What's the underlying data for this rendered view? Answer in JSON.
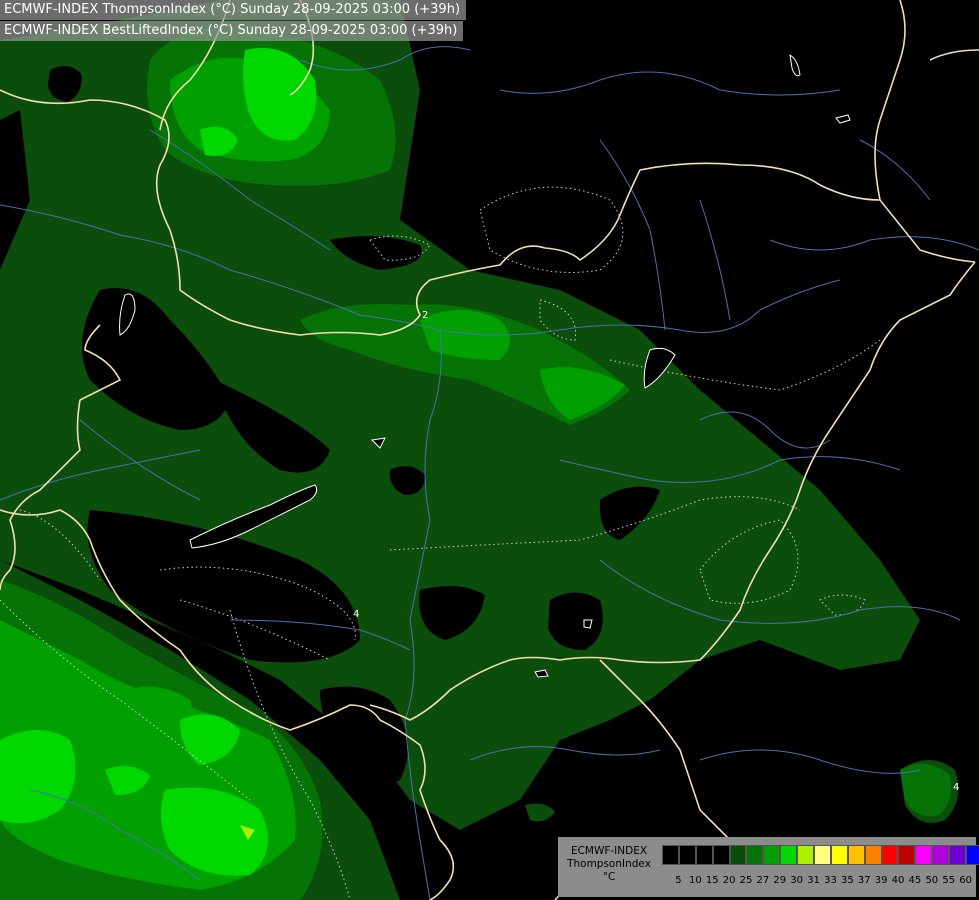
{
  "title": {
    "line1": "ECMWF-INDEX ThompsonIndex (°C) Sunday 28-09-2025 03:00 (+39h)",
    "line2": "ECMWF-INDEX BestLiftedIndex (°C) Sunday 28-09-2025 03:00 (+39h)"
  },
  "legend": {
    "model": "ECMWF-INDEX",
    "parameter": "ThompsonIndex",
    "unit": "°C",
    "ticks": [
      "5",
      "10",
      "15",
      "20",
      "25",
      "27",
      "29",
      "30",
      "31",
      "33",
      "35",
      "37",
      "39",
      "40",
      "45",
      "50",
      "55",
      "60"
    ],
    "colors": [
      "#000000",
      "#000000",
      "#000000",
      "#000000",
      "#0b4d0b",
      "#057305",
      "#00a000",
      "#00d800",
      "#aaf000",
      "#ffff80",
      "#ffff00",
      "#ffc000",
      "#ff8000",
      "#ff0000",
      "#c00000",
      "#ff00ff",
      "#b000e0",
      "#7000d0",
      "#0000ff"
    ]
  },
  "contour_labels": [
    "2",
    "4",
    "4"
  ],
  "colors": {
    "background": "#000000",
    "level_25": "#0b4d0b",
    "level_27": "#057305",
    "level_29": "#00a000",
    "level_30": "#00d800",
    "border": "#f5deb3",
    "river": "#4a6fb0"
  }
}
